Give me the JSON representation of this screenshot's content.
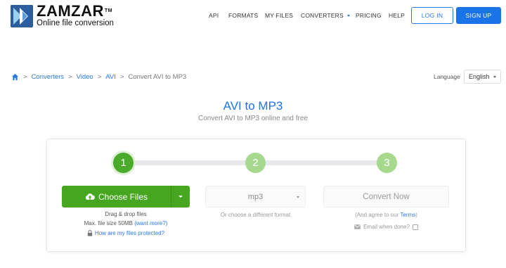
{
  "header": {
    "logo_name": "ZAMZAR",
    "logo_tm": "TM",
    "logo_tagline": "Online file conversion",
    "nav": {
      "api": "API",
      "formats": "FORMATS",
      "my_files": "MY FILES",
      "converters": "CONVERTERS",
      "pricing": "PRICING",
      "help": "HELP"
    },
    "login_label": "LOG IN",
    "signup_label": "SIGN UP"
  },
  "breadcrumb": {
    "items": [
      "Converters",
      "Video",
      "AVI"
    ],
    "current": "Convert AVI to MP3",
    "separator": ">"
  },
  "language": {
    "label": "Language",
    "selected": "English"
  },
  "page": {
    "title": "AVI to MP3",
    "subtitle": "Convert AVI to MP3 online and free"
  },
  "steps": {
    "step1": "1",
    "step2": "2",
    "step3": "3",
    "choose_files_label": "Choose Files",
    "drag_drop": "Drag & drop files",
    "max_size_prefix": "Max. file size 50MB",
    "want_more": "(want more?)",
    "protected_link": "How are my files protected?",
    "format_selected": "mp3",
    "format_hint": "Or choose a different format",
    "convert_label": "Convert Now",
    "agree_prefix": "(And agree to our",
    "agree_terms": "Terms",
    "agree_suffix": ")",
    "email_label": "Email when done?"
  },
  "colors": {
    "brand_blue": "#1b73e8",
    "green": "#47a620",
    "green_light": "#a6d88e"
  }
}
